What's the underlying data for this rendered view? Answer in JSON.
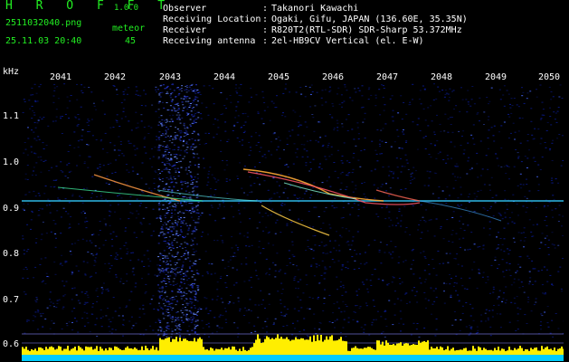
{
  "header": {
    "brand": "H R O F F T",
    "version": "1.0.0",
    "filename": "2511032040.png",
    "datetime": "25.11.03 20:40",
    "meteor_label": "meteor",
    "meteor_count": "45"
  },
  "info": [
    {
      "label": "Observer",
      "value": "Takanori Kawachi"
    },
    {
      "label": "Receiving Location",
      "value": "Ogaki, Gifu, JAPAN (136.60E, 35.35N)"
    },
    {
      "label": "Receiver",
      "value": "R820T2(RTL-SDR) SDR-Sharp 53.372MHz"
    },
    {
      "label": "Receiving antenna",
      "value": "2el-HB9CV Vertical (el. E-W)"
    }
  ],
  "info_colon": ":",
  "axis": {
    "y_unit": "kHz",
    "x_ticks": [
      "2041",
      "2042",
      "2043",
      "2044",
      "2045",
      "2046",
      "2047",
      "2048",
      "2049",
      "2050"
    ],
    "y_ticks": [
      "1.1",
      "1.0",
      "0.9",
      "0.8",
      "0.7",
      "0.6"
    ]
  },
  "colors": {
    "background": "#000000",
    "noise": "#0a1a8c",
    "carrier": "#33ccff",
    "histogram_fill": "#ffee00",
    "histogram_base": "#00ccff",
    "text_green": "#22ee22",
    "text_white": "#ffffff"
  }
}
